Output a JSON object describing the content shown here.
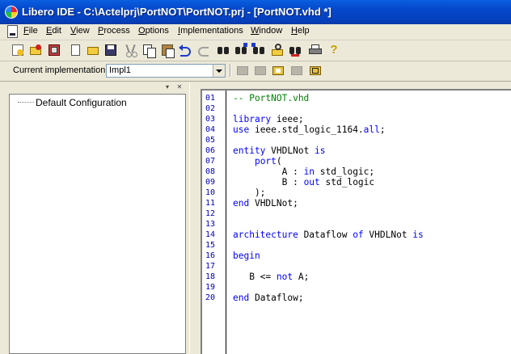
{
  "window": {
    "title": "Libero IDE - C:\\Actelprj\\PortNOT\\PortNOT.prj - [PortNOT.vhd *]"
  },
  "menubar": {
    "items": [
      {
        "underline": "F",
        "rest": "ile"
      },
      {
        "underline": "E",
        "rest": "dit"
      },
      {
        "underline": "V",
        "rest": "iew"
      },
      {
        "underline": "P",
        "rest": "rocess"
      },
      {
        "underline": "O",
        "rest": "ptions"
      },
      {
        "underline": "I",
        "rest": "mplementations"
      },
      {
        "underline": "W",
        "rest": "indow"
      },
      {
        "underline": "H",
        "rest": "elp"
      }
    ]
  },
  "toolbar": {
    "icons": [
      "new-project-icon",
      "open-project-icon",
      "project-settings-icon",
      "new-file-icon",
      "open-file-icon",
      "save-icon",
      "cut-icon",
      "copy-icon",
      "paste-icon",
      "undo-icon",
      "redo-icon",
      "find-icon",
      "find-next-icon",
      "replace-icon",
      "find-in-files-icon",
      "goto-icon",
      "compile-icon",
      "print-icon",
      "help-icon"
    ]
  },
  "implementation": {
    "label": "Current implementation:",
    "value": "Impl1"
  },
  "tree": {
    "root": "Default Configuration"
  },
  "editor": {
    "lines": [
      {
        "n": "01",
        "tokens": [
          {
            "t": "-- PortNOT.vhd",
            "s": "c"
          }
        ]
      },
      {
        "n": "02",
        "tokens": []
      },
      {
        "n": "03",
        "tokens": [
          {
            "t": "library",
            "s": "k"
          },
          {
            "t": " ieee;",
            "s": ""
          }
        ]
      },
      {
        "n": "04",
        "tokens": [
          {
            "t": "use",
            "s": "k"
          },
          {
            "t": " ieee.std_logic_1164.",
            "s": ""
          },
          {
            "t": "all",
            "s": "k"
          },
          {
            "t": ";",
            "s": ""
          }
        ]
      },
      {
        "n": "05",
        "tokens": []
      },
      {
        "n": "06",
        "tokens": [
          {
            "t": "entity",
            "s": "k"
          },
          {
            "t": " VHDLNot ",
            "s": ""
          },
          {
            "t": "is",
            "s": "k"
          }
        ]
      },
      {
        "n": "07",
        "tokens": [
          {
            "t": "    ",
            "s": ""
          },
          {
            "t": "port",
            "s": "k"
          },
          {
            "t": "(",
            "s": ""
          }
        ]
      },
      {
        "n": "08",
        "tokens": [
          {
            "t": "         A : ",
            "s": ""
          },
          {
            "t": "in",
            "s": "k"
          },
          {
            "t": " std_logic;",
            "s": ""
          }
        ]
      },
      {
        "n": "09",
        "tokens": [
          {
            "t": "         B : ",
            "s": ""
          },
          {
            "t": "out",
            "s": "k"
          },
          {
            "t": " std_logic",
            "s": ""
          }
        ]
      },
      {
        "n": "10",
        "tokens": [
          {
            "t": "    );",
            "s": ""
          }
        ]
      },
      {
        "n": "11",
        "tokens": [
          {
            "t": "end",
            "s": "k"
          },
          {
            "t": " VHDLNot;",
            "s": ""
          }
        ]
      },
      {
        "n": "12",
        "tokens": []
      },
      {
        "n": "13",
        "tokens": []
      },
      {
        "n": "14",
        "tokens": [
          {
            "t": "architecture",
            "s": "k"
          },
          {
            "t": " Dataflow ",
            "s": ""
          },
          {
            "t": "of",
            "s": "k"
          },
          {
            "t": " VHDLNot ",
            "s": ""
          },
          {
            "t": "is",
            "s": "k"
          }
        ]
      },
      {
        "n": "15",
        "tokens": []
      },
      {
        "n": "16",
        "tokens": [
          {
            "t": "begin",
            "s": "k"
          }
        ]
      },
      {
        "n": "17",
        "tokens": []
      },
      {
        "n": "18",
        "tokens": [
          {
            "t": "   B <= ",
            "s": ""
          },
          {
            "t": "not",
            "s": "k"
          },
          {
            "t": " A;",
            "s": ""
          }
        ]
      },
      {
        "n": "19",
        "tokens": []
      },
      {
        "n": "20",
        "tokens": [
          {
            "t": "end",
            "s": "k"
          },
          {
            "t": " Dataflow;",
            "s": ""
          }
        ]
      }
    ]
  }
}
